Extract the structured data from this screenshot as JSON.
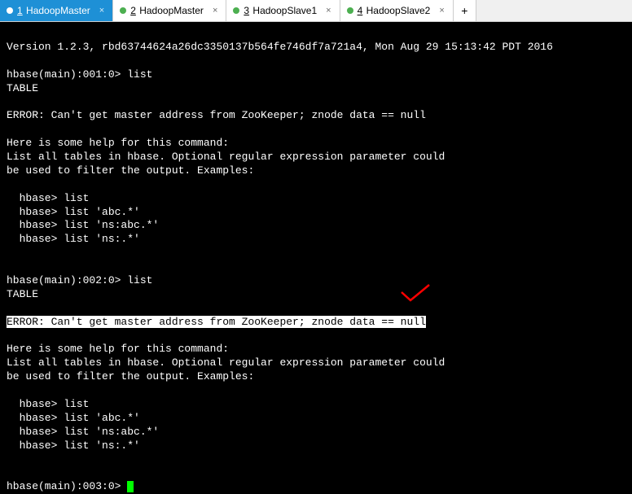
{
  "tabs": [
    {
      "num": "1",
      "label": "HadoopMaster",
      "active": true
    },
    {
      "num": "2",
      "label": "HadoopMaster",
      "active": false
    },
    {
      "num": "3",
      "label": "HadoopSlave1",
      "active": false
    },
    {
      "num": "4",
      "label": "HadoopSlave2",
      "active": false
    }
  ],
  "add_tab": "+",
  "terminal": {
    "version_line": "Version 1.2.3, rbd63744624a26dc3350137b564fe746df7a721a4, Mon Aug 29 15:13:42 PDT 2016",
    "blank": "",
    "prompt1": "hbase(main):001:0> list",
    "table1": "TABLE",
    "error1": "ERROR: Can't get master address from ZooKeeper; znode data == null",
    "help_header1": "Here is some help for this command:",
    "help_line1a": "List all tables in hbase. Optional regular expression parameter could",
    "help_line1b": "be used to filter the output. Examples:",
    "ex1a": "  hbase> list",
    "ex1b": "  hbase> list 'abc.*'",
    "ex1c": "  hbase> list 'ns:abc.*'",
    "ex1d": "  hbase> list 'ns:.*'",
    "prompt2": "hbase(main):002:0> list",
    "table2": "TABLE",
    "error2": "ERROR: Can't get master address from ZooKeeper; znode data == null",
    "help_header2": "Here is some help for this command:",
    "help_line2a": "List all tables in hbase. Optional regular expression parameter could",
    "help_line2b": "be used to filter the output. Examples:",
    "ex2a": "  hbase> list",
    "ex2b": "  hbase> list 'abc.*'",
    "ex2c": "  hbase> list 'ns:abc.*'",
    "ex2d": "  hbase> list 'ns:.*'",
    "prompt3": "hbase(main):003:0> "
  }
}
